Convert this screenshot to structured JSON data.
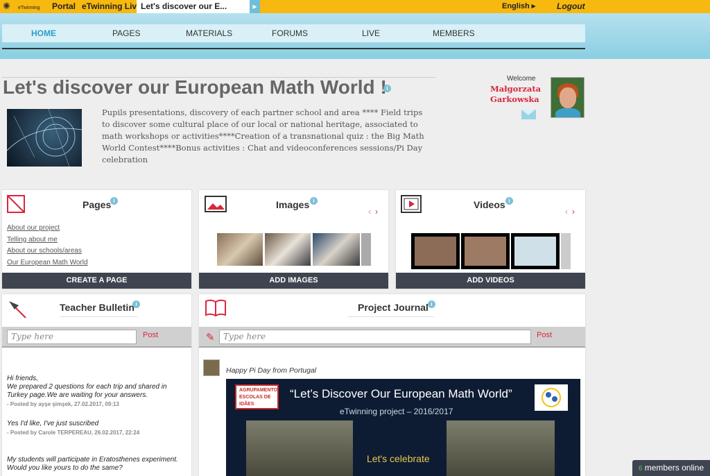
{
  "topbar": {
    "logo_text": "eTwinning",
    "links": [
      "Portal",
      "eTwinning Live"
    ],
    "active_tab": "Let's discover our E...",
    "language": "English",
    "logout": "Logout"
  },
  "nav": {
    "items": [
      "HOME",
      "PAGES",
      "MATERIALS",
      "FORUMS",
      "LIVE",
      "MEMBERS"
    ],
    "active": "HOME"
  },
  "header": {
    "title": "Let's discover our European Math World !",
    "description": "Pupils presentations, discovery of each partner school and area **** Field trips to discover some cultural place of our local or national heritage, associated to math workshops or activities****Creation of a transnational quiz : the Big Math World Contest****Bonus activities : Chat and videoconferences sessions/Pi Day celebration",
    "welcome": "Welcome",
    "user_first": "Małgorzata",
    "user_last": "Garkowska"
  },
  "pages_card": {
    "title": "Pages",
    "links": [
      "About our project",
      "Telling about me",
      "About our schools/areas",
      "Our European Math World"
    ],
    "button": "CREATE A PAGE"
  },
  "images_card": {
    "title": "Images",
    "button": "ADD IMAGES"
  },
  "videos_card": {
    "title": "Videos",
    "button": "ADD VIDEOS"
  },
  "bulletin": {
    "title": "Teacher Bulletin",
    "placeholder": "Type here",
    "post_label": "Post",
    "posts": [
      {
        "text": "Hi friends,\nWe prepared 2 questions for each trip and shared in Turkey page.We are waiting for your answers.",
        "meta": "- Posted by ayşe şimşek, 27.02.2017, 09:13"
      },
      {
        "text": "Yes I'd like, I've just suscribed",
        "meta": "- Posted by Carole TERPEREAU, 26.02.2017, 22:24"
      },
      {
        "text": "My students will participate in Eratosthenes experiment. Would you like yours to do the same?",
        "meta": ""
      }
    ]
  },
  "journal": {
    "title": "Project Journal",
    "placeholder": "Type here",
    "post_label": "Post",
    "entry_text": "Happy Pi Day from Portugal",
    "banner_logo_text": "AGRUPAMENTO ESCOLAS DE IDÃES",
    "banner_title": "“Let’s Discover Our European Math World”",
    "banner_subtitle": "eTwinning project – 2016/2017",
    "banner_celebrate": "Let's celebrate"
  },
  "members_online": {
    "count": "6",
    "label": "members online"
  },
  "colors": {
    "topbar": "#f7b90f",
    "accent": "#2a9fc9",
    "brand_red": "#d9263f",
    "button_dark": "#3e4450"
  }
}
